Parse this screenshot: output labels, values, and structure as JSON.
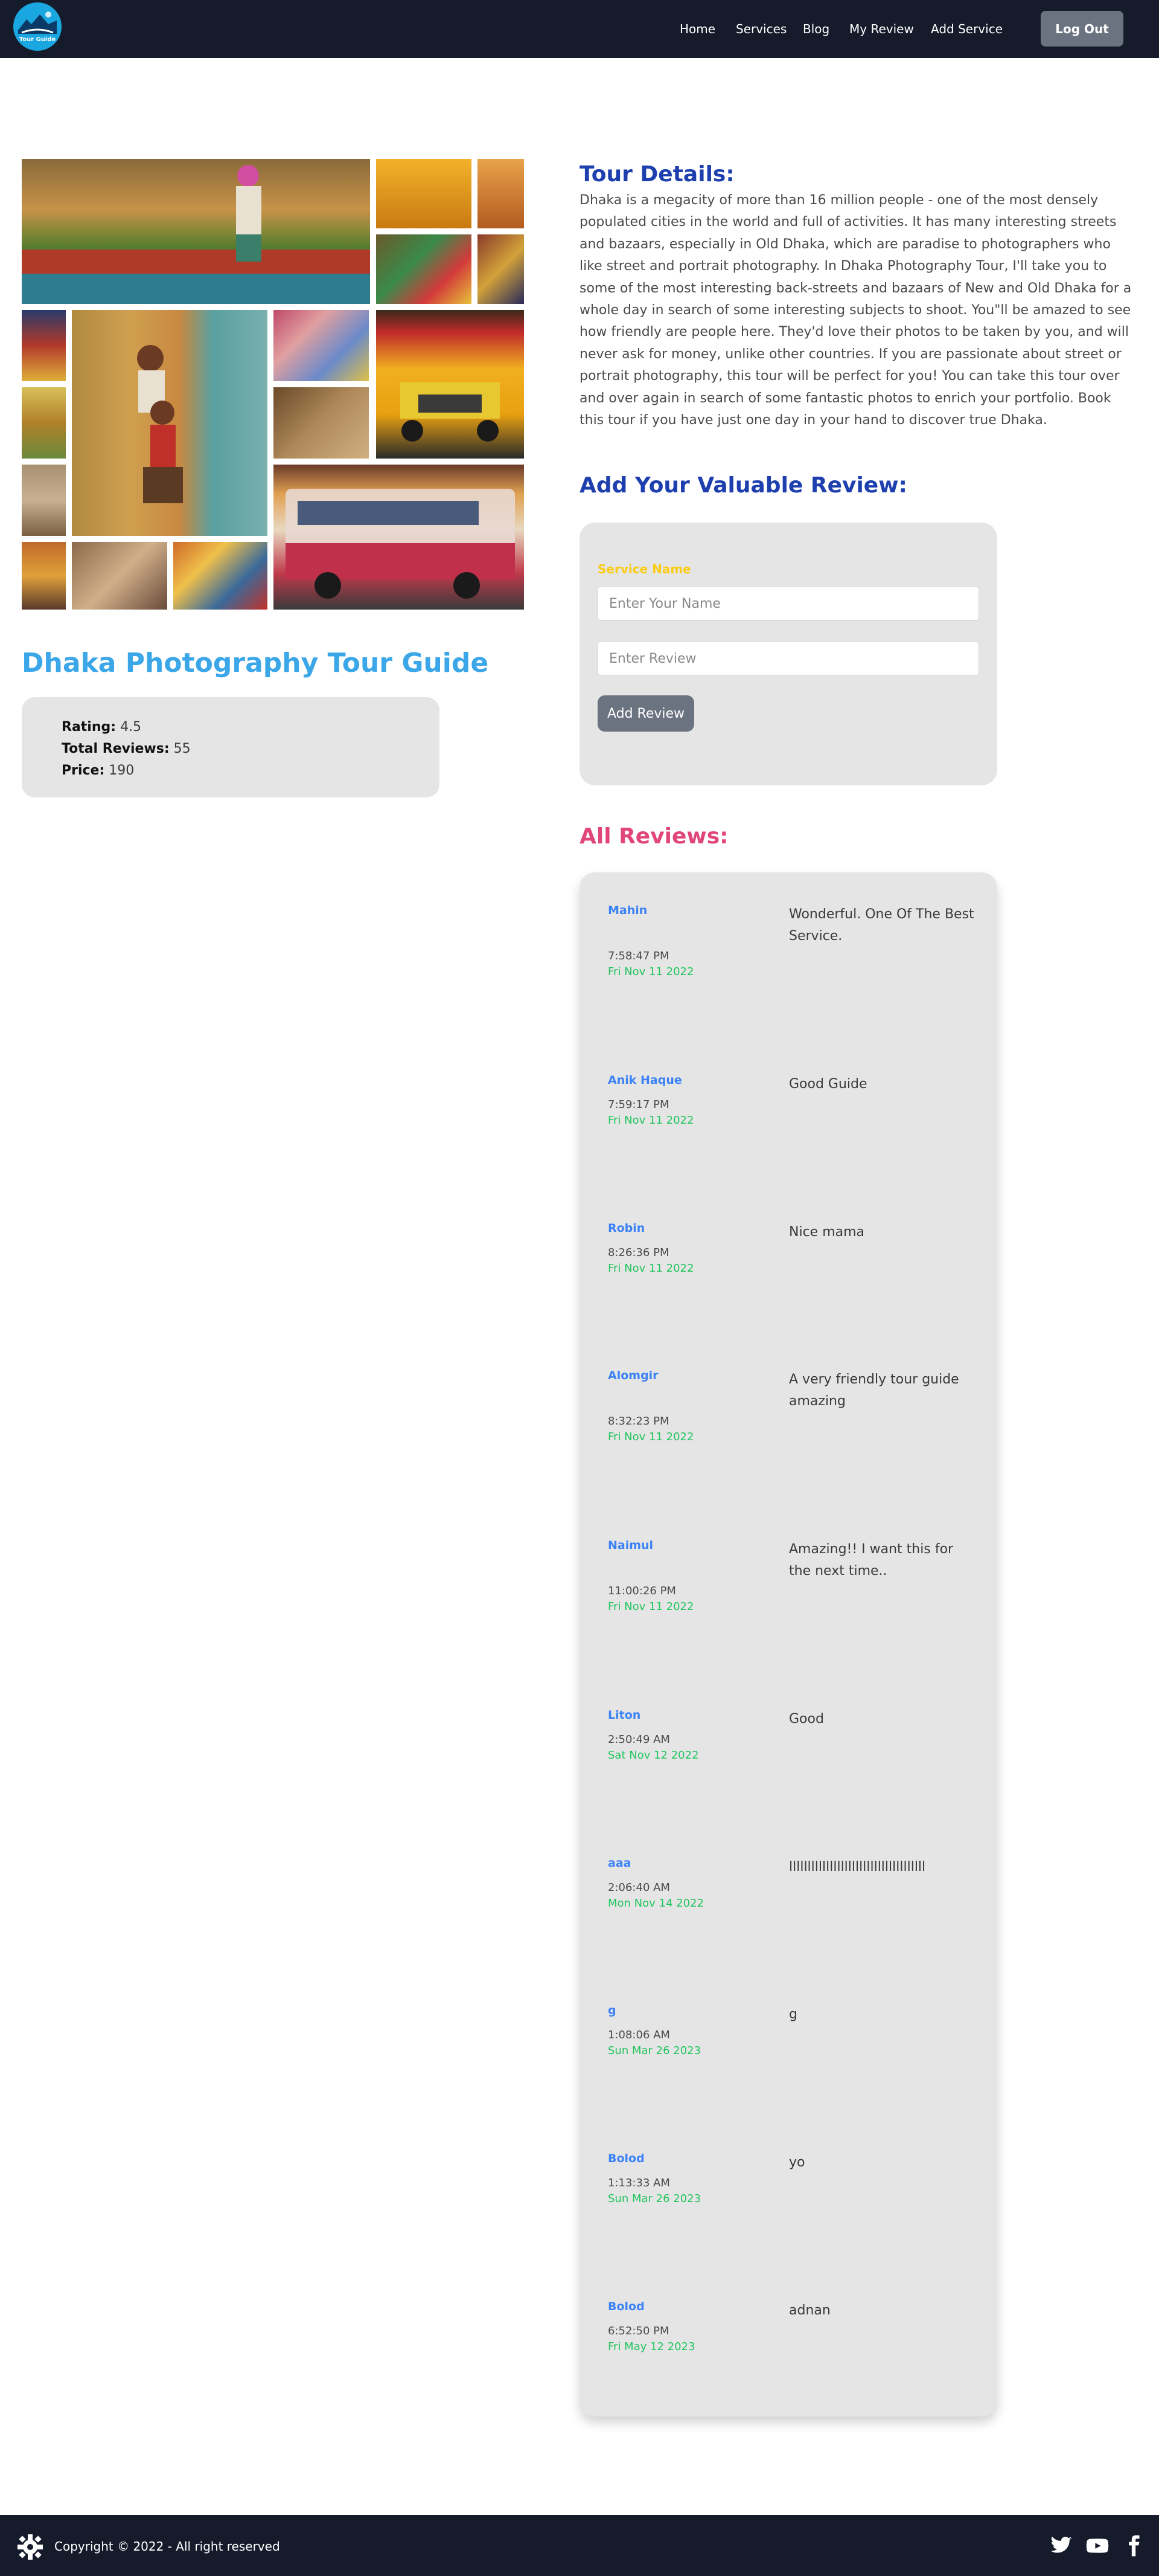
{
  "nav": {
    "logo_text": "Tour Guide",
    "links": [
      "Home",
      "Services",
      "Blog",
      "My Review",
      "Add Service"
    ],
    "logout": "Log Out"
  },
  "service": {
    "title": "Dhaka Photography Tour Guide",
    "rating_label": "Rating:",
    "rating": "4.5",
    "reviews_label": "Total Reviews:",
    "reviews": "55",
    "price_label": "Price:",
    "price": "190"
  },
  "details": {
    "heading": "Tour Details:",
    "text": "Dhaka is a megacity of more than 16 million people - one of the most densely populated cities in the world and full of activities. It has many interesting streets and bazaars, especially in Old Dhaka, which are paradise to photographers who like street and portrait photography. In Dhaka Photography Tour, I'll take you to some of the most interesting back-streets and bazaars of New and Old Dhaka for a whole day in search of some interesting subjects to shoot. You\"ll be amazed to see how friendly are people here. They'd love their photos to be taken by you, and will never ask for money, unlike other countries. If you are passionate about street or portrait photography, this tour will be perfect for you! You can take this tour over and over again in search of some fantastic photos to enrich your portfolio. Book this tour if you have just one day in your hand to discover true Dhaka."
  },
  "review_form": {
    "heading": "Add Your Valuable Review:",
    "service_label": "Service Name",
    "name_placeholder": "Enter Your Name",
    "review_placeholder": "Enter Review",
    "submit": "Add Review"
  },
  "reviews": {
    "heading": "All Reviews:",
    "items": [
      {
        "name": "Mahin",
        "time": "7:58:47 PM",
        "date": "Fri Nov 11 2022",
        "text": "Wonderful. One Of The Best Service."
      },
      {
        "name": "Anik Haque",
        "time": "7:59:17 PM",
        "date": "Fri Nov 11 2022",
        "text": "Good Guide"
      },
      {
        "name": "Robin",
        "time": "8:26:36 PM",
        "date": "Fri Nov 11 2022",
        "text": "Nice mama"
      },
      {
        "name": "Alomgir",
        "time": "8:32:23 PM",
        "date": "Fri Nov 11 2022",
        "text": "A very friendly tour guide amazing"
      },
      {
        "name": "Naimul",
        "time": "11:00:26 PM",
        "date": "Fri Nov 11 2022",
        "text": "Amazing!! I want this for the next time.."
      },
      {
        "name": "Liton",
        "time": "2:50:49 AM",
        "date": "Sat Nov 12 2022",
        "text": "Good"
      },
      {
        "name": "aaa",
        "time": "2:06:40 AM",
        "date": "Mon Nov 14 2022",
        "text": "lllllllllllllllllllllllllllllllllllll"
      },
      {
        "name": "g",
        "time": "1:08:06 AM",
        "date": "Sun Mar 26 2023",
        "text": "g"
      },
      {
        "name": "Bolod",
        "time": "1:13:33 AM",
        "date": "Sun Mar 26 2023",
        "text": "yo"
      },
      {
        "name": "Bolod",
        "time": "6:52:50 PM",
        "date": "Fri May 12 2023",
        "text": "adnan"
      }
    ]
  },
  "footer": {
    "copyright": "Copyright © 2022 - All right reserved",
    "social": [
      "twitter-icon",
      "youtube-icon",
      "facebook-icon"
    ]
  }
}
